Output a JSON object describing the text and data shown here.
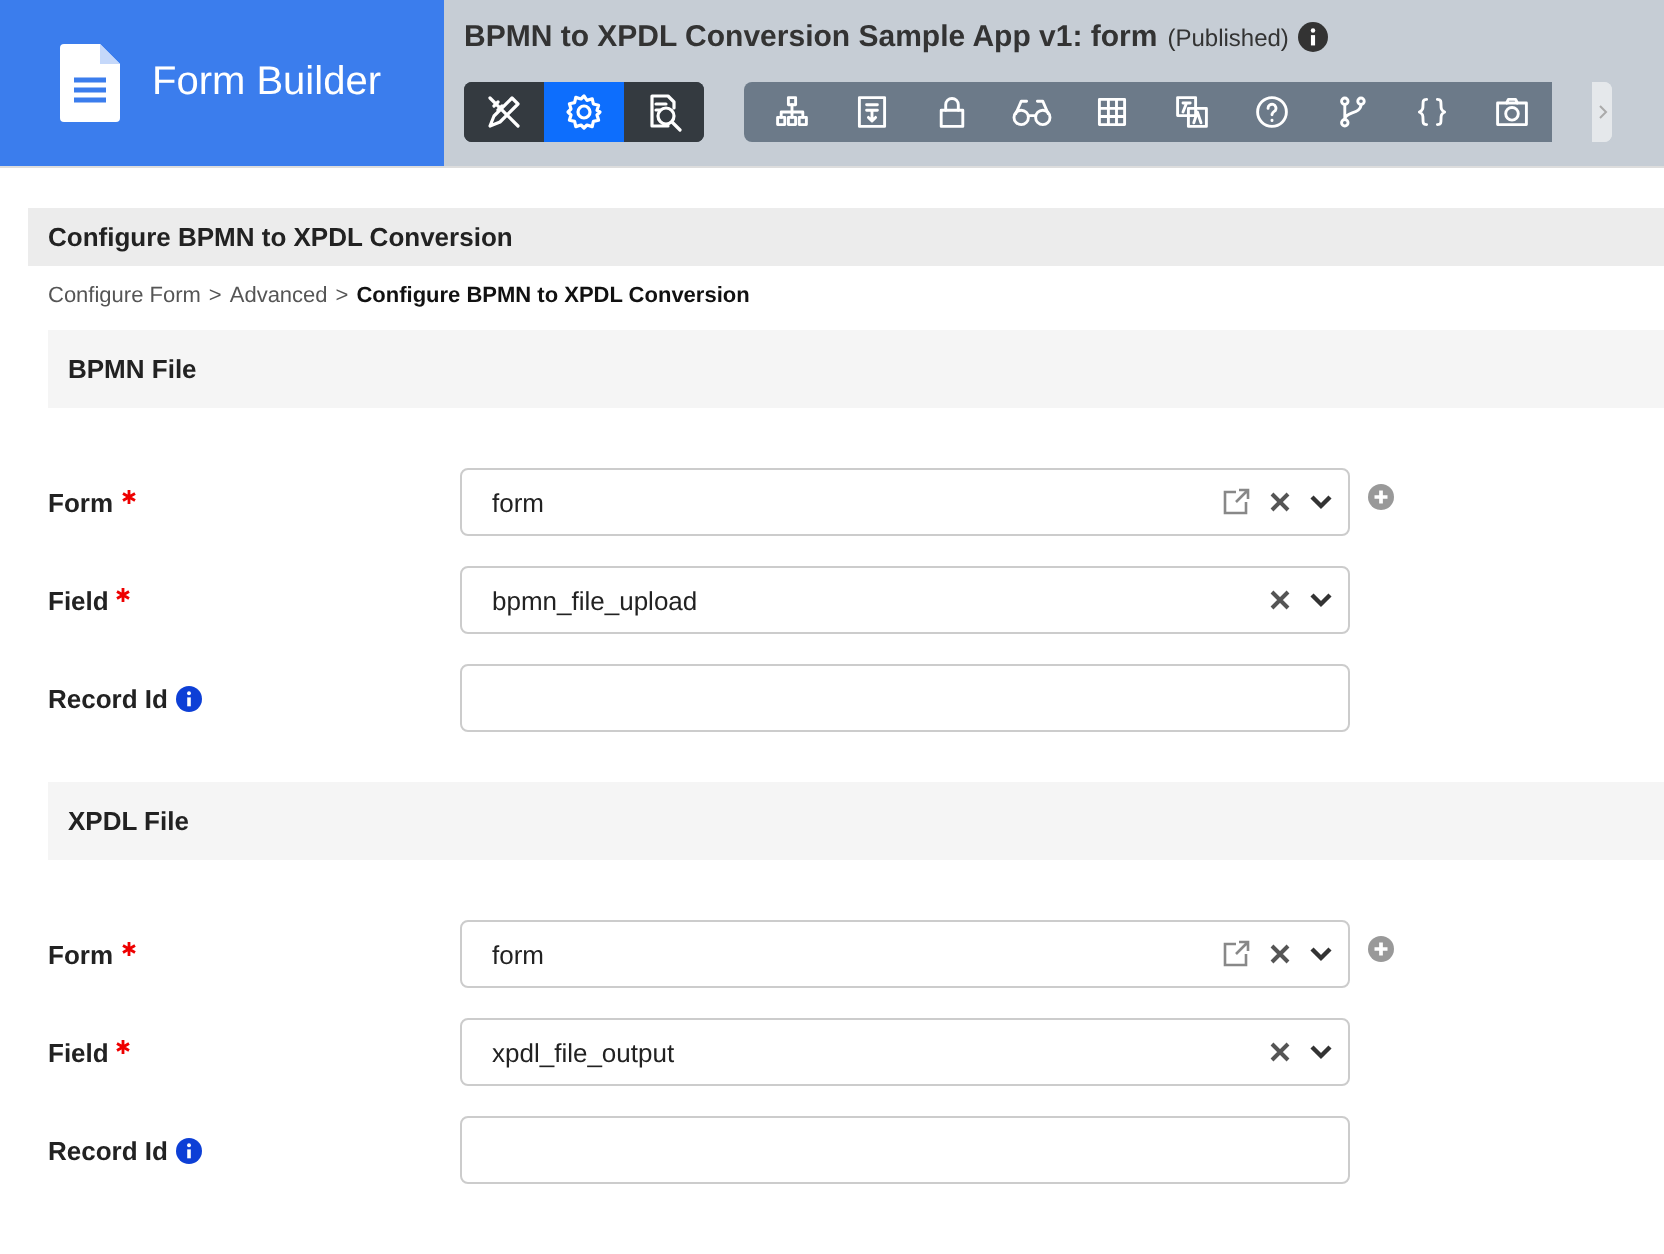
{
  "header": {
    "app_name": "Form Builder",
    "title": "BPMN to XPDL Conversion Sample App v1: form",
    "status": "(Published)",
    "mode_buttons": [
      {
        "kind": "design",
        "selected": false
      },
      {
        "kind": "settings",
        "selected": true
      },
      {
        "kind": "preview",
        "selected": false
      }
    ],
    "tools": [
      {
        "kind": "tree"
      },
      {
        "kind": "form"
      },
      {
        "kind": "lock"
      },
      {
        "kind": "binoculars"
      },
      {
        "kind": "grid"
      },
      {
        "kind": "translate"
      },
      {
        "kind": "help"
      },
      {
        "kind": "branch"
      },
      {
        "kind": "braces"
      },
      {
        "kind": "camera"
      }
    ]
  },
  "panel": {
    "title": "Configure BPMN to XPDL Conversion",
    "breadcrumb_separator": ">",
    "breadcrumb": [
      {
        "text": "Configure Form",
        "current": false
      },
      {
        "text": "Advanced",
        "current": false
      },
      {
        "text": "Configure BPMN to XPDL Conversion",
        "current": true
      }
    ],
    "sections": [
      {
        "title": "BPMN File",
        "fields": [
          {
            "label": "Form",
            "required": true,
            "info": false,
            "kind": "select-edit",
            "value": "form"
          },
          {
            "label": "Field",
            "required": true,
            "info": false,
            "kind": "select",
            "value": "bpmn_file_upload"
          },
          {
            "label": "Record Id",
            "required": false,
            "info": true,
            "kind": "text"
          }
        ]
      },
      {
        "title": "XPDL File",
        "fields": [
          {
            "label": "Form",
            "required": true,
            "info": false,
            "kind": "select-edit",
            "value": "form"
          },
          {
            "label": "Field",
            "required": true,
            "info": false,
            "kind": "select",
            "value": "xpdl_file_output"
          },
          {
            "label": "Record Id",
            "required": false,
            "info": true,
            "kind": "text"
          }
        ]
      }
    ]
  }
}
